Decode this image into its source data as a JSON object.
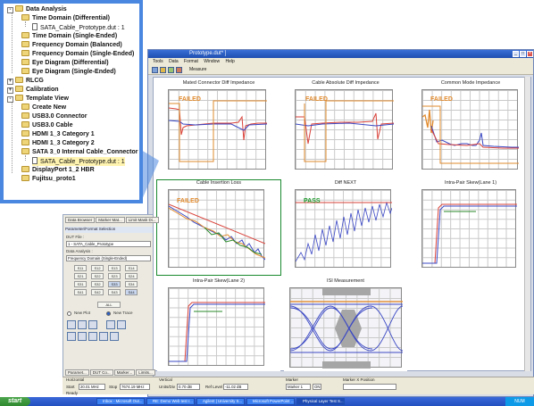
{
  "colors": {
    "accent": "#4a87e0",
    "failed": "#e28b2e",
    "pass": "#1e9b2c",
    "titlebar": "#2a5fc8"
  },
  "window": {
    "title": "Prototype.dut* ]",
    "menu": [
      "Tools",
      "Data",
      "Format",
      "Window",
      "Help"
    ],
    "toolbar": {
      "measure_label": "Measure"
    }
  },
  "plots": [
    {
      "title": "Mated Connector Diff Impedance",
      "status": "FAILED"
    },
    {
      "title": "Cable Absolute Diff Impedance",
      "status": "FAILED"
    },
    {
      "title": "Common Mode Impedance",
      "status": "FAILED"
    },
    {
      "title": "Cable Insertion Loss",
      "status": "FAILED"
    },
    {
      "title": "Diff NEXT",
      "status": "PASS"
    },
    {
      "title": "Intra-Pair Skew(Lane 1)",
      "status": ""
    },
    {
      "title": "Intra-Pair Skew(Lane 2)",
      "status": ""
    },
    {
      "title": "ISI Measurement",
      "status": ""
    }
  ],
  "left_pane": {
    "tabs": [
      "Data Browser",
      "Marker Mat...",
      "Limit Mask Di..."
    ],
    "section_title": "Parameter/Format Selection",
    "dut_file_label": "DUT File :",
    "dut_file_value": "1 - SATA_Cable_Prototype",
    "data_analysis_label": "Data Analysis :",
    "data_analysis_value": "Frequency Domain (Single-Ended)",
    "sparams": [
      [
        "S11",
        "S12",
        "S13",
        "S14"
      ],
      [
        "S21",
        "S22",
        "S23",
        "S24"
      ],
      [
        "S31",
        "S32",
        "S33",
        "S34"
      ],
      [
        "S41",
        "S42",
        "S43",
        "S44"
      ]
    ],
    "all_label": "ALL",
    "new_plot_label": "New Plot",
    "new_trace_label": "New Trace",
    "bottom_tabs": [
      "Paramet...",
      "DUT Co...",
      "Marker...",
      "Limits..."
    ]
  },
  "bottom_bar": {
    "horizontal_label": "Horizontal",
    "start_label": "Start",
    "start_value": "20.01 MHz",
    "stop_label": "Stop",
    "stop_value": "7674.19 MHz",
    "vertical_label": "Vertical",
    "units_label": "Units/Div",
    "units_value": "0.70 dB",
    "ref_label": "Ref Level",
    "ref_value": "-11.02 dB",
    "marker_label": "Marker",
    "marker_value": "Marker 1",
    "marker_on": "ON",
    "marker_pos_label": "Marker X Position",
    "ready": "Ready"
  },
  "taskbar": {
    "start": "start",
    "tasks": [
      "Inbox - Microsoft Out...",
      "RE: Demo Web test r...",
      "Agilent | University S...",
      "Microsoft PowerPoint ...",
      "Physical Layer Test S..."
    ],
    "clock": "NUM"
  },
  "tree": {
    "items": [
      {
        "label": "Data Analysis",
        "type": "folder",
        "expander": "-"
      },
      {
        "label": "Time Domain (Differential)",
        "type": "folder"
      },
      {
        "label": "SATA_Cable_Prototype.dut : 1",
        "type": "doc"
      },
      {
        "label": "Time Domain (Single-Ended)",
        "type": "folder"
      },
      {
        "label": "Frequency Domain (Balanced)",
        "type": "folder"
      },
      {
        "label": "Frequency Domain (Single-Ended)",
        "type": "folder"
      },
      {
        "label": "Eye Diagram (Differential)",
        "type": "folder"
      },
      {
        "label": "Eye Diagram (Single-Ended)",
        "type": "folder"
      },
      {
        "label": "RLCG",
        "type": "folder",
        "expander": "+"
      },
      {
        "label": "Calibration",
        "type": "folder",
        "expander": "+"
      },
      {
        "label": "Template View",
        "type": "folder",
        "expander": "-"
      },
      {
        "label": "Create New",
        "type": "folder"
      },
      {
        "label": "USB3.0 Connector",
        "type": "folder"
      },
      {
        "label": "USB3.0 Cable",
        "type": "folder"
      },
      {
        "label": "HDMI 1_3 Category 1",
        "type": "folder"
      },
      {
        "label": "HDMI 1_3 Category 2",
        "type": "folder"
      },
      {
        "label": "SATA 3_0 Internal Cable_Connector",
        "type": "folder"
      },
      {
        "label": "SATA_Cable_Prototype.dut : 1",
        "type": "doc"
      },
      {
        "label": "DisplayPort 1_2 HBR",
        "type": "folder"
      },
      {
        "label": "Fujitsu_proto1",
        "type": "folder"
      }
    ]
  }
}
